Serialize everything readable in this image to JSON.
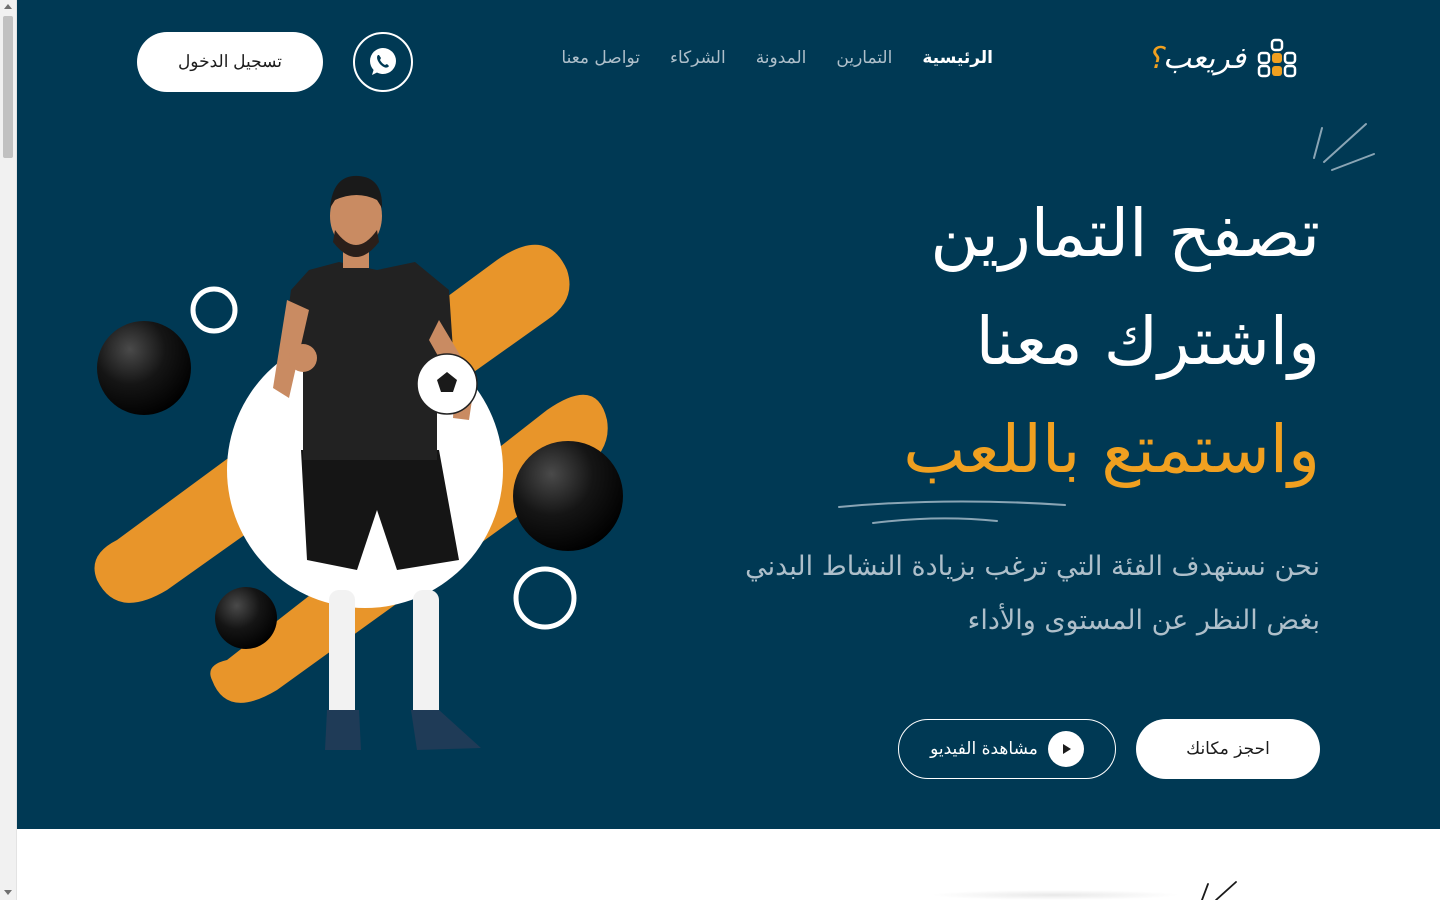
{
  "header": {
    "logo_text": "فريعب",
    "logo_mark": "؟",
    "login_label": "تسجيل الدخول",
    "nav": [
      {
        "label": "الرئيسية",
        "active": true
      },
      {
        "label": "التمارين",
        "active": false
      },
      {
        "label": "المدونة",
        "active": false
      },
      {
        "label": "الشركاء",
        "active": false
      },
      {
        "label": "تواصل معنا",
        "active": false
      }
    ]
  },
  "hero": {
    "line1": "تصفح التمارين",
    "line2": "واشترك معنا",
    "line3": "واستمتع باللعب",
    "subtitle": "نحن نستهدف الفئة التي ترغب بزيادة النشاط البدني بغض النظر عن المستوى والأداء",
    "book_label": "احجز مكانك",
    "video_label": "مشاهدة الفيديو"
  },
  "colors": {
    "background": "#003954",
    "accent": "#f0a020",
    "muted_text": "#aebfca"
  },
  "icons": {
    "whatsapp": "whatsapp-icon",
    "play": "play-icon",
    "logo": "dots-grid-icon"
  }
}
